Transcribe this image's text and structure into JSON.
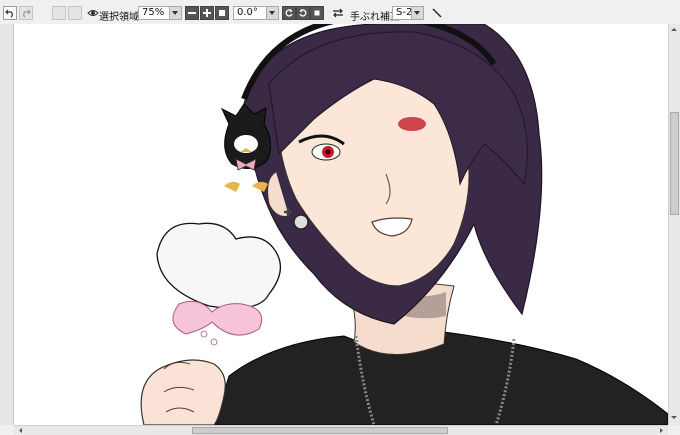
{
  "toolbar": {
    "selection_label": "選択領域",
    "zoom_value": "75%",
    "rotation_value": "0.0°",
    "stabilization_label": "手ぶれ補正",
    "stabilization_value": "S-2"
  },
  "icons": [
    "undo-icon",
    "redo-icon",
    "eye-icon",
    "zoom-out-icon",
    "zoom-in-icon",
    "fit-icon",
    "rotate-left-icon",
    "rotate-right-icon",
    "reset-rotation-icon",
    "flip-icon",
    "pen-icon",
    "scroll-up-icon",
    "scroll-down-icon",
    "scroll-left-icon",
    "scroll-right-icon"
  ]
}
